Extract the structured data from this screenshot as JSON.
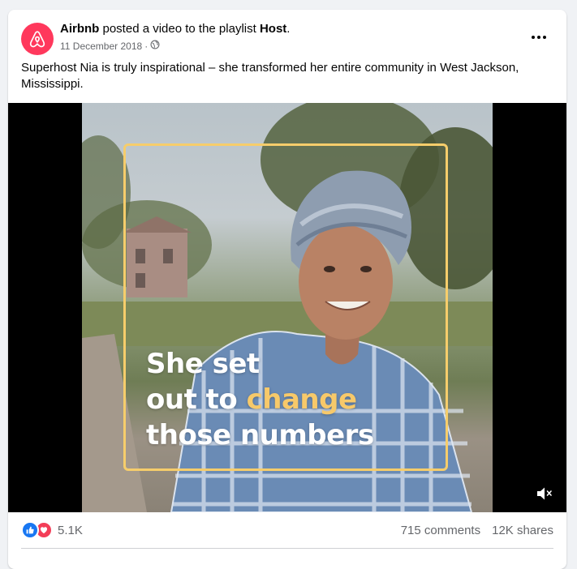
{
  "post": {
    "page_name": "Airbnb",
    "action_text": " posted a video to the playlist ",
    "playlist_name": "Host",
    "trailing_punct": ".",
    "date": "11 December 2018",
    "separator": "·",
    "privacy_icon": "globe-icon",
    "caption": "Superhost Nia is truly inspirational – she transformed her entire community in West Jackson, Mississippi."
  },
  "video": {
    "overlay_line1": "She set",
    "overlay_line2_prefix": "out to ",
    "overlay_line2_highlight": "change",
    "overlay_line3": "those numbers",
    "mute_icon": "volume-muted-icon",
    "highlight_color": "#f7c96a",
    "frame_color": "#f6cd6b"
  },
  "stats": {
    "reaction_count": "5.1K",
    "comments": "715 comments",
    "shares": "12K shares"
  },
  "colors": {
    "brand": "#ff385c",
    "like": "#1877f2",
    "love": "#f33e58"
  }
}
